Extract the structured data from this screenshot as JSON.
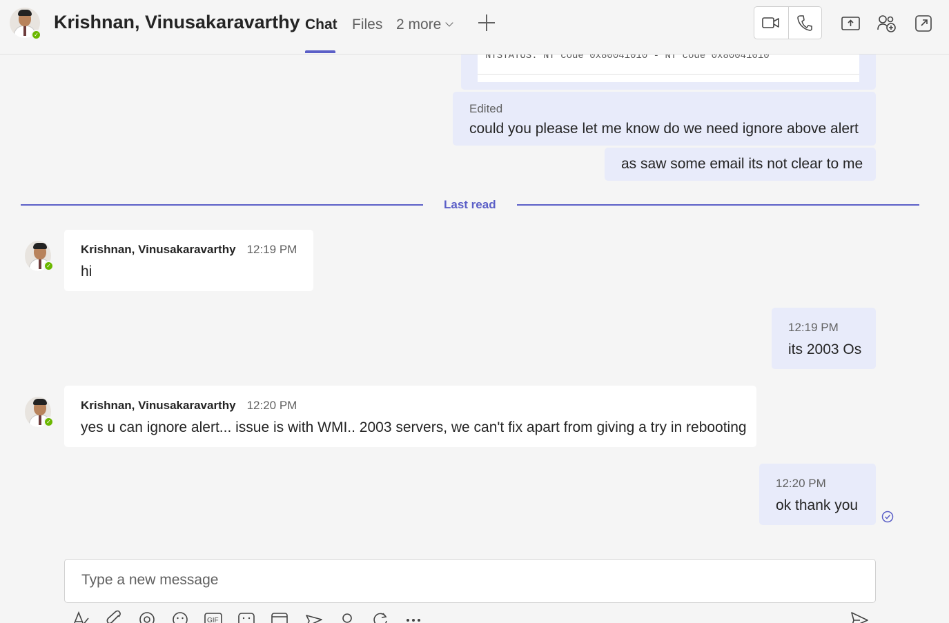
{
  "header": {
    "contact_name": "Krishnan, Vinusakaravarthy",
    "tabs": [
      {
        "label": "Chat",
        "active": true
      },
      {
        "label": "Files",
        "active": false
      },
      {
        "label": "2 more",
        "active": false
      }
    ],
    "icons": [
      "video-call-icon",
      "audio-call-icon",
      "share-screen-icon",
      "add-people-icon",
      "pop-out-icon"
    ]
  },
  "attachment_preview": {
    "text": "NTSTATUS: NT code 0x80041010 - NT code 0x80041010"
  },
  "messages_before": [
    {
      "edited_label": "Edited",
      "text": "could you please let me know do we need ignore above alert"
    },
    {
      "text": "as saw some email its not clear to me"
    }
  ],
  "last_read_label": "Last read",
  "messages": [
    {
      "sender": "Krishnan, Vinusakaravarthy",
      "time": "12:19 PM",
      "text": "hi"
    },
    {
      "time": "12:19 PM",
      "text": "its 2003 Os"
    },
    {
      "sender": "Krishnan, Vinusakaravarthy",
      "time": "12:20 PM",
      "text": "yes u can ignore alert... issue is with WMI.. 2003 servers, we can't fix apart from giving a try in rebooting"
    },
    {
      "time": "12:20 PM",
      "text": "ok thank you"
    }
  ],
  "compose": {
    "placeholder": "Type a new message",
    "toolbar": [
      "format-icon",
      "attach-icon",
      "loop-icon",
      "emoji-icon",
      "gif-icon",
      "sticker-icon",
      "schedule-meeting-icon",
      "stream-icon",
      "praise-icon",
      "updates-icon",
      "more-options-icon",
      "send-icon"
    ]
  },
  "colors": {
    "accent": "#5b5fc7",
    "my_bubble": "#e8ebfa",
    "their_bubble": "#ffffff",
    "presence_available": "#6bb700"
  }
}
